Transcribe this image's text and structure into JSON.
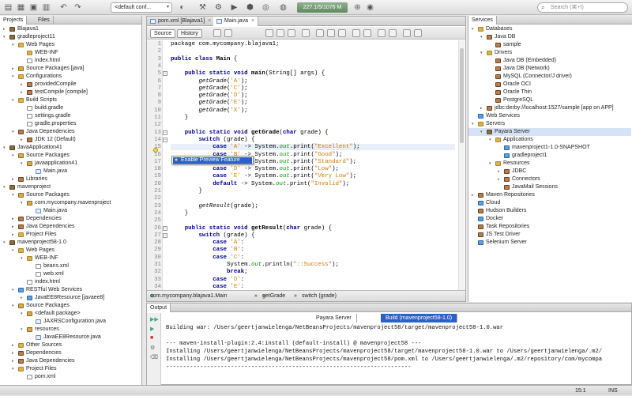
{
  "toolbar": {
    "config": "<default conf...",
    "memory": "227.1/5/1076 M",
    "search_placeholder": "Search (⌘+I)"
  },
  "projects_tabs": [
    "Projects",
    "Files"
  ],
  "projects_tree": [
    {
      "label": "Blajava1",
      "d": 0,
      "tw": "▸",
      "ic": "proj"
    },
    {
      "label": "gradleproject11",
      "d": 0,
      "tw": "▾",
      "ic": "proj"
    },
    {
      "label": "Web Pages",
      "d": 1,
      "tw": "▾",
      "ic": "fold"
    },
    {
      "label": "WEB-INF",
      "d": 2,
      "tw": "",
      "ic": "fold"
    },
    {
      "label": "index.html",
      "d": 2,
      "tw": "",
      "ic": "file"
    },
    {
      "label": "Source Packages [java]",
      "d": 1,
      "tw": "▸",
      "ic": "pkg"
    },
    {
      "label": "Configurations",
      "d": 1,
      "tw": "▾",
      "ic": "fold"
    },
    {
      "label": "providedCompile",
      "d": 2,
      "tw": "▸",
      "ic": "jar"
    },
    {
      "label": "testCompile [compile]",
      "d": 2,
      "tw": "▸",
      "ic": "jar"
    },
    {
      "label": "Build Scripts",
      "d": 1,
      "tw": "▾",
      "ic": "fold"
    },
    {
      "label": "build.gradle",
      "d": 2,
      "tw": "",
      "ic": "file"
    },
    {
      "label": "settings.gradle",
      "d": 2,
      "tw": "",
      "ic": "file"
    },
    {
      "label": "gradle.properties",
      "d": 2,
      "tw": "",
      "ic": "file"
    },
    {
      "label": "Java Dependencies",
      "d": 1,
      "tw": "▾",
      "ic": "jar"
    },
    {
      "label": "JDK 12 (Default)",
      "d": 2,
      "tw": "▸",
      "ic": "jar"
    },
    {
      "label": "JavaApplication41",
      "d": 0,
      "tw": "▾",
      "ic": "proj"
    },
    {
      "label": "Source Packages",
      "d": 1,
      "tw": "▾",
      "ic": "pkg"
    },
    {
      "label": "javaapplication41",
      "d": 2,
      "tw": "▾",
      "ic": "pkg"
    },
    {
      "label": "Main.java",
      "d": 3,
      "tw": "",
      "ic": "java"
    },
    {
      "label": "Libraries",
      "d": 1,
      "tw": "▸",
      "ic": "jar"
    },
    {
      "label": "mavenproject",
      "d": 0,
      "tw": "▾",
      "ic": "proj"
    },
    {
      "label": "Source Packages",
      "d": 1,
      "tw": "▾",
      "ic": "pkg"
    },
    {
      "label": "com.mycompany.mavenproject",
      "d": 2,
      "tw": "▾",
      "ic": "pkg"
    },
    {
      "label": "Main.java",
      "d": 3,
      "tw": "",
      "ic": "java"
    },
    {
      "label": "Dependencies",
      "d": 1,
      "tw": "▸",
      "ic": "jar"
    },
    {
      "label": "Java Dependencies",
      "d": 1,
      "tw": "▸",
      "ic": "jar"
    },
    {
      "label": "Project Files",
      "d": 1,
      "tw": "▸",
      "ic": "fold"
    },
    {
      "label": "mavenproject58-1.0",
      "d": 0,
      "tw": "▾",
      "ic": "proj"
    },
    {
      "label": "Web Pages",
      "d": 1,
      "tw": "▾",
      "ic": "fold"
    },
    {
      "label": "WEB-INF",
      "d": 2,
      "tw": "▾",
      "ic": "fold"
    },
    {
      "label": "beans.xml",
      "d": 3,
      "tw": "",
      "ic": "file"
    },
    {
      "label": "web.xml",
      "d": 3,
      "tw": "",
      "ic": "file"
    },
    {
      "label": "index.html",
      "d": 2,
      "tw": "",
      "ic": "file"
    },
    {
      "label": "RESTful Web Services",
      "d": 1,
      "tw": "▾",
      "ic": "globe"
    },
    {
      "label": "JavaEE8Resource [javaee8]",
      "d": 2,
      "tw": "▸",
      "ic": "globe"
    },
    {
      "label": "Source Packages",
      "d": 1,
      "tw": "▾",
      "ic": "pkg"
    },
    {
      "label": "<default package>",
      "d": 2,
      "tw": "▾",
      "ic": "pkg"
    },
    {
      "label": "JAXRSConfiguration.java",
      "d": 3,
      "tw": "",
      "ic": "java"
    },
    {
      "label": "resources",
      "d": 2,
      "tw": "▾",
      "ic": "pkg"
    },
    {
      "label": "JavaEE8Resource.java",
      "d": 3,
      "tw": "",
      "ic": "java"
    },
    {
      "label": "Other Sources",
      "d": 1,
      "tw": "▸",
      "ic": "fold"
    },
    {
      "label": "Dependencies",
      "d": 1,
      "tw": "▸",
      "ic": "jar"
    },
    {
      "label": "Java Dependencies",
      "d": 1,
      "tw": "▸",
      "ic": "jar"
    },
    {
      "label": "Project Files",
      "d": 1,
      "tw": "▾",
      "ic": "fold"
    },
    {
      "label": "pom.xml",
      "d": 2,
      "tw": "",
      "ic": "file"
    }
  ],
  "editor_tabs": [
    "pom.xml [Blajava1]",
    "Main.java"
  ],
  "editor_buttons": [
    "Source",
    "History"
  ],
  "code_lines": [
    {
      "n": "1",
      "h": "package com.mycompany.blajava1;"
    },
    {
      "n": "2",
      "h": ""
    },
    {
      "n": "3",
      "h": "<span class='kw'>public class</span> <b>Main</b> {"
    },
    {
      "n": "4",
      "h": ""
    },
    {
      "n": "5",
      "h": "    <span class='kw'>public static void</span> <span class='mth'>main</span>(String[] args) {",
      "f": "−"
    },
    {
      "n": "6",
      "h": "        <span class='it'>getGrade</span>(<span class='str'>'A'</span>);"
    },
    {
      "n": "7",
      "h": "        <span class='it'>getGrade</span>(<span class='str'>'C'</span>);"
    },
    {
      "n": "8",
      "h": "        <span class='it'>getGrade</span>(<span class='str'>'D'</span>);"
    },
    {
      "n": "9",
      "h": "        <span class='it'>getGrade</span>(<span class='str'>'E'</span>);"
    },
    {
      "n": "10",
      "h": "        <span class='it'>getGrade</span>(<span class='str'>'X'</span>);"
    },
    {
      "n": "11",
      "h": "    }"
    },
    {
      "n": "12",
      "h": ""
    },
    {
      "n": "13",
      "h": "    <span class='kw'>public static void</span> <span class='mth'>getGrade</span>(<span class='kw'>char</span> grade) {",
      "f": "−"
    },
    {
      "n": "14",
      "h": "        <span class='kw'>switch</span> (grade) {",
      "f": "−"
    },
    {
      "n": "15",
      "h": "            <span class='kw'>case</span> <span class='str'>'A'</span> -> System.<span class='fld'>out</span>.print(<span class='str'>\"Excellent\"</span>);",
      "hl": true
    },
    {
      "n": "16",
      "h": "            <span class='kw'>case</span> <span class='str'>'B'</span> -> System.<span class='fld'>out</span>.print(<span class='str'>\"Good\"</span>);"
    },
    {
      "n": "17",
      "h": "            <span class='kw'>case</span> <span class='str'>'C'</span> -> System.<span class='fld'>out</span>.print(<span class='str'>\"Standard\"</span>);"
    },
    {
      "n": "18",
      "h": "            <span class='kw'>case</span> <span class='str'>'D'</span> -> System.<span class='fld'>out</span>.print(<span class='str'>\"Low\"</span>);"
    },
    {
      "n": "19",
      "h": "            <span class='kw'>case</span> <span class='str'>'E'</span> -> System.<span class='fld'>out</span>.print(<span class='str'>\"Very Low\"</span>);"
    },
    {
      "n": "20",
      "h": "            <span class='kw'>default</span> -> System.<span class='fld'>out</span>.print(<span class='str'>\"Invalid\"</span>);"
    },
    {
      "n": "21",
      "h": "        }"
    },
    {
      "n": "22",
      "h": ""
    },
    {
      "n": "23",
      "h": "        <span class='it'>getResult</span>(grade);"
    },
    {
      "n": "24",
      "h": "    }"
    },
    {
      "n": "25",
      "h": ""
    },
    {
      "n": "26",
      "h": "    <span class='kw'>public static void</span> <span class='mth'>getResult</span>(<span class='kw'>char</span> grade) {",
      "f": "−"
    },
    {
      "n": "27",
      "h": "        <span class='kw'>switch</span> (grade) {",
      "f": "−"
    },
    {
      "n": "28",
      "h": "            <span class='kw'>case</span> <span class='str'>'A'</span>:"
    },
    {
      "n": "29",
      "h": "            <span class='kw'>case</span> <span class='str'>'B'</span>:"
    },
    {
      "n": "30",
      "h": "            <span class='kw'>case</span> <span class='str'>'C'</span>:"
    },
    {
      "n": "31",
      "h": "                System.<span class='fld'>out</span>.println(<span class='str'>\"::Success\"</span>);"
    },
    {
      "n": "32",
      "h": "                <span class='kw'>break</span>;"
    },
    {
      "n": "33",
      "h": "            <span class='kw'>case</span> <span class='str'>'D'</span>:"
    },
    {
      "n": "34",
      "h": "            <span class='kw'>case</span> <span class='str'>'E'</span>:"
    }
  ],
  "popup": {
    "label": "Enable Preview Feature"
  },
  "breadcrumbs": [
    "com.mycompany.blajava1.Main",
    "getGrade",
    "switch (grade)"
  ],
  "services_tabs": [
    "Services"
  ],
  "services_tree": [
    {
      "label": "Databases",
      "d": 0,
      "tw": "▾",
      "ic": "fold"
    },
    {
      "label": "Java DB",
      "d": 1,
      "tw": "▾",
      "ic": "jar"
    },
    {
      "label": "sample",
      "d": 2,
      "tw": "",
      "ic": "jar"
    },
    {
      "label": "Drivers",
      "d": 1,
      "tw": "▾",
      "ic": "fold"
    },
    {
      "label": "Java DB (Embedded)",
      "d": 2,
      "tw": "",
      "ic": "jar"
    },
    {
      "label": "Java DB (Network)",
      "d": 2,
      "tw": "",
      "ic": "jar"
    },
    {
      "label": "MySQL (Connector/J driver)",
      "d": 2,
      "tw": "",
      "ic": "jar"
    },
    {
      "label": "Oracle OCI",
      "d": 2,
      "tw": "",
      "ic": "jar"
    },
    {
      "label": "Oracle Thin",
      "d": 2,
      "tw": "",
      "ic": "jar"
    },
    {
      "label": "PostgreSQL",
      "d": 2,
      "tw": "",
      "ic": "jar"
    },
    {
      "label": "jdbc:derby://localhost:1527/sample [app on APP]",
      "d": 1,
      "tw": "▸",
      "ic": "jar"
    },
    {
      "label": "Web Services",
      "d": 0,
      "tw": "",
      "ic": "globe"
    },
    {
      "label": "Servers",
      "d": 0,
      "tw": "▾",
      "ic": "fold"
    },
    {
      "label": "Payara Server",
      "d": 1,
      "tw": "▾",
      "ic": "proj",
      "sel": true
    },
    {
      "label": "Applications",
      "d": 2,
      "tw": "▾",
      "ic": "fold"
    },
    {
      "label": "mavenproject1-1.0-SNAPSHOT",
      "d": 3,
      "tw": "",
      "ic": "globe"
    },
    {
      "label": "gradleproject1",
      "d": 3,
      "tw": "",
      "ic": "globe"
    },
    {
      "label": "Resources",
      "d": 2,
      "tw": "▾",
      "ic": "fold"
    },
    {
      "label": "JDBC",
      "d": 3,
      "tw": "▸",
      "ic": "jar"
    },
    {
      "label": "Connectors",
      "d": 3,
      "tw": "▸",
      "ic": "jar"
    },
    {
      "label": "JavaMail Sessions",
      "d": 3,
      "tw": "",
      "ic": "jar"
    },
    {
      "label": "Maven Repositories",
      "d": 0,
      "tw": "▸",
      "ic": "jar"
    },
    {
      "label": "Cloud",
      "d": 0,
      "tw": "",
      "ic": "globe"
    },
    {
      "label": "Hudson Builders",
      "d": 0,
      "tw": "",
      "ic": "jar"
    },
    {
      "label": "Docker",
      "d": 0,
      "tw": "",
      "ic": "globe"
    },
    {
      "label": "Task Repositories",
      "d": 0,
      "tw": "",
      "ic": "jar"
    },
    {
      "label": "JS Test Driver",
      "d": 0,
      "tw": "",
      "ic": "jar"
    },
    {
      "label": "Selenium Server",
      "d": 0,
      "tw": "",
      "ic": "globe"
    }
  ],
  "output": {
    "title": "Output",
    "tabs": [
      "Payara Server",
      "Build (mavenproject58-1.0)"
    ],
    "lines": [
      "Building war: /Users/geertjanwielenga/NetBeansProjects/mavenproject58/target/mavenproject58-1.0.war",
      "",
      "--- maven-install-plugin:2.4:install (default-install) @ mavenproject58 ---",
      "Installing /Users/geertjanwielenga/NetBeansProjects/mavenproject58/target/mavenproject58-1.0.war to /Users/geertjanwielenga/.m2/",
      "Installing /Users/geertjanwielenga/NetBeansProjects/mavenproject58/pom.xml to /Users/geertjanwielenga/.m2/repository/com/mycompa",
      "------------------------------------------------------------------------"
    ]
  },
  "status": {
    "position": "15:1",
    "mode": "INS"
  },
  "colors": {
    "accent": "#2a61c8",
    "keyword": "#00008b",
    "string": "#ce7b00"
  }
}
